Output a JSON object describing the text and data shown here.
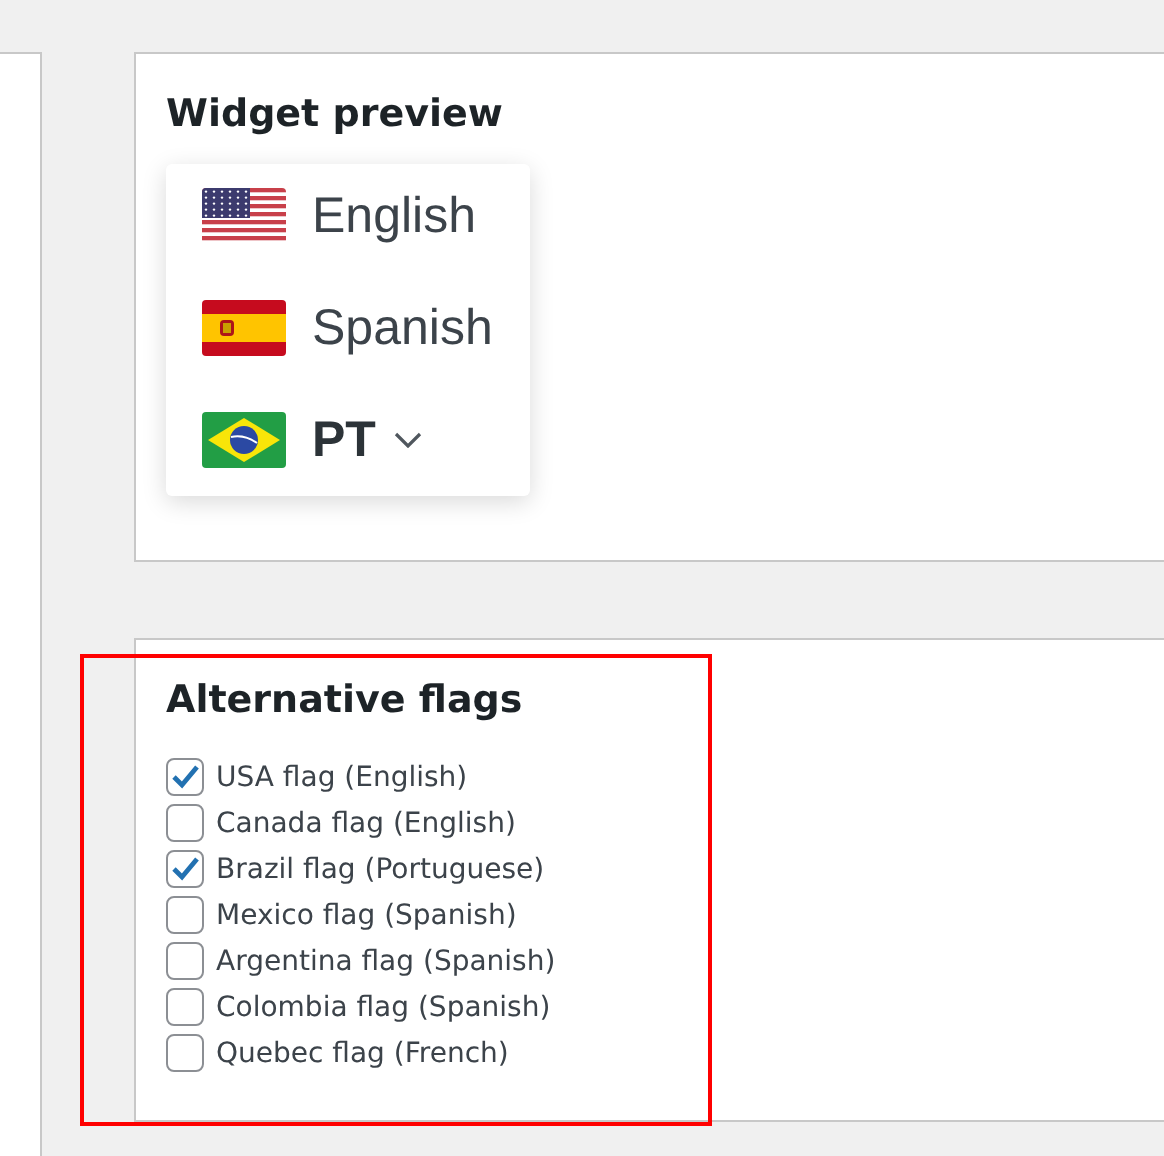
{
  "widget_preview": {
    "title": "Widget preview",
    "languages": [
      {
        "kind": "us",
        "label": "English",
        "selected": false
      },
      {
        "kind": "es",
        "label": "Spanish",
        "selected": false
      },
      {
        "kind": "br",
        "label": "PT",
        "selected": true
      }
    ]
  },
  "alternative_flags": {
    "title": "Alternative flags",
    "highlighted": true,
    "options": [
      {
        "label": "USA flag (English)",
        "checked": true
      },
      {
        "label": "Canada flag (English)",
        "checked": false
      },
      {
        "label": "Brazil flag (Portuguese)",
        "checked": true
      },
      {
        "label": "Mexico flag (Spanish)",
        "checked": false
      },
      {
        "label": "Argentina flag (Spanish)",
        "checked": false
      },
      {
        "label": "Colombia flag (Spanish)",
        "checked": false
      },
      {
        "label": "Quebec flag (French)",
        "checked": false
      }
    ]
  }
}
